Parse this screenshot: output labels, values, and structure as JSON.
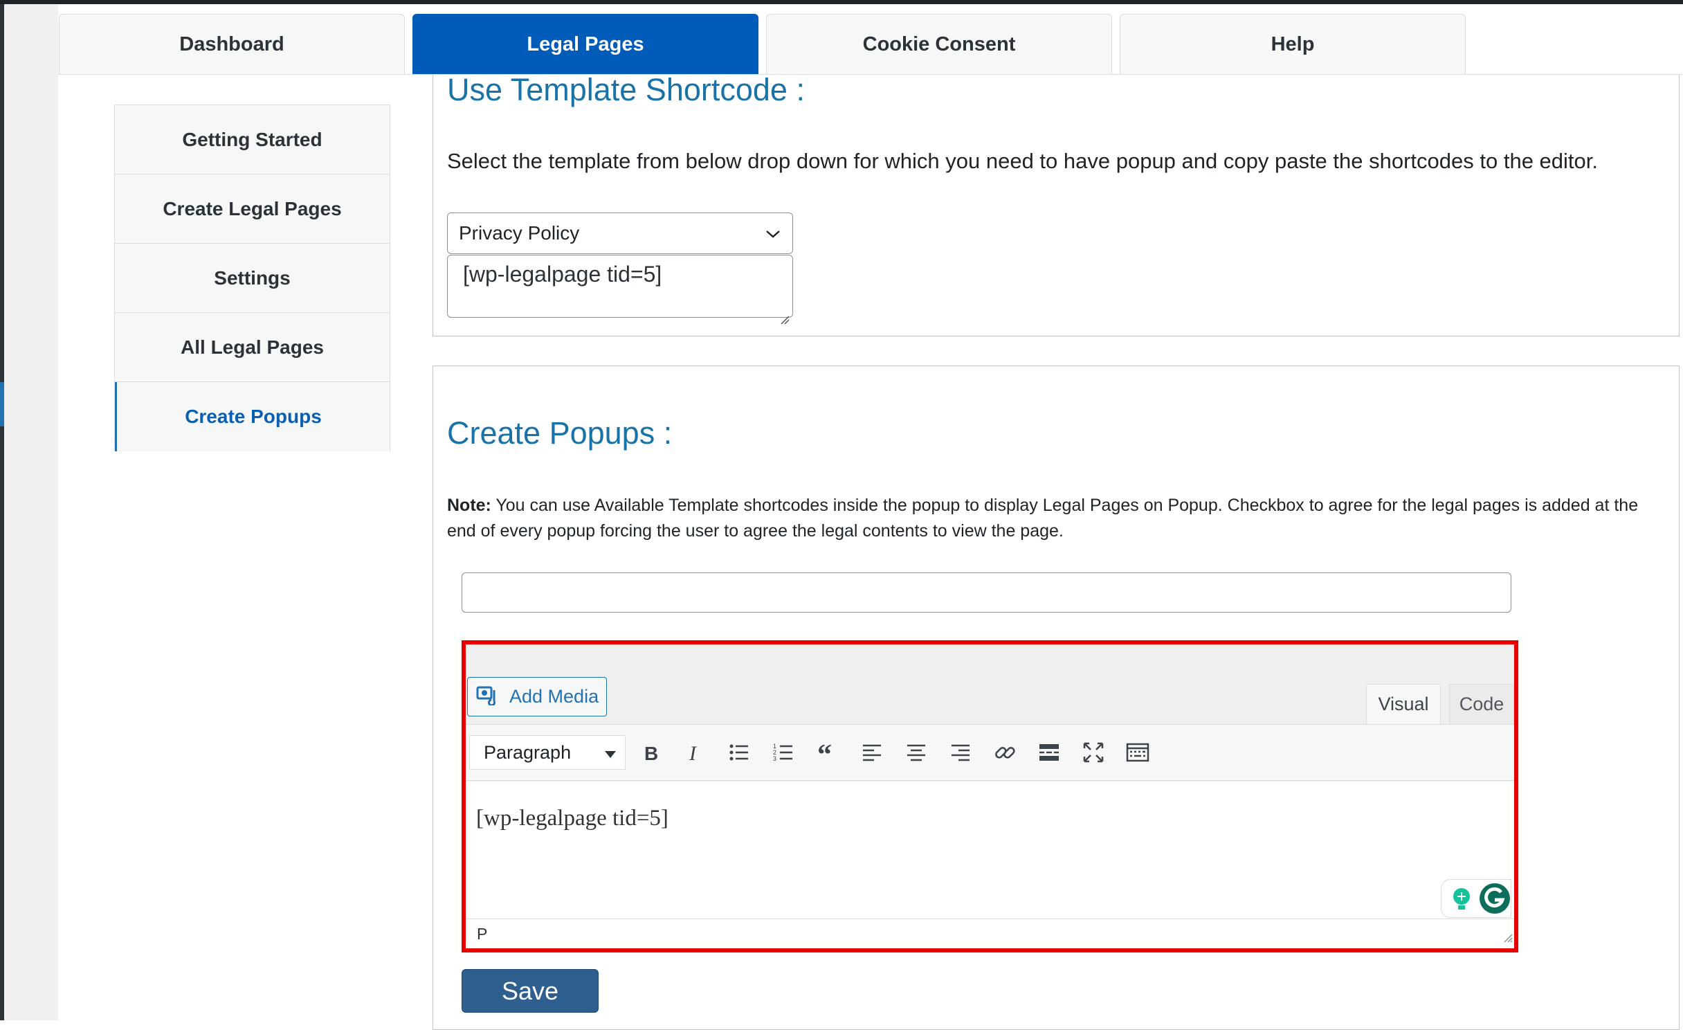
{
  "tabs": [
    {
      "label": "Dashboard"
    },
    {
      "label": "Legal Pages"
    },
    {
      "label": "Cookie Consent"
    },
    {
      "label": "Help"
    }
  ],
  "active_tab": "Legal Pages",
  "sidebar": {
    "items": [
      {
        "label": "Getting Started"
      },
      {
        "label": "Create Legal Pages"
      },
      {
        "label": "Settings"
      },
      {
        "label": "All Legal Pages"
      },
      {
        "label": "Create Popups"
      }
    ],
    "active_item": "Create Popups"
  },
  "template_section": {
    "heading": "Use Template Shortcode :",
    "description": "Select the template from below drop down for which you need to have popup and copy paste the shortcodes to the editor.",
    "selected_template": "Privacy Policy",
    "shortcode": "[wp-legalpage tid=5]"
  },
  "popups_section": {
    "heading": "Create Popups :",
    "note_label": "Note:",
    "note_text": " You can use Available Template shortcodes inside the popup to display Legal Pages on Popup. Checkbox to agree for the legal pages is added at the end of every popup forcing the user to agree the legal contents to view the page.",
    "title_value": ""
  },
  "editor": {
    "add_media_label": "Add Media",
    "mode_visual": "Visual",
    "mode_code": "Code",
    "format_select": "Paragraph",
    "toolbar_icons": [
      "bold-icon",
      "italic-icon",
      "bullet-list-icon",
      "numbered-list-icon",
      "blockquote-icon",
      "align-left-icon",
      "align-center-icon",
      "align-right-icon",
      "link-icon",
      "read-more-icon",
      "fullscreen-icon",
      "toolbar-toggle-icon"
    ],
    "content": "[wp-legalpage tid=5]",
    "status_path": "P"
  },
  "save_label": "Save",
  "colors": {
    "accent": "#005cb8",
    "heading": "#1a73a8",
    "highlight": "#e60000",
    "save": "#2e5f8f"
  }
}
